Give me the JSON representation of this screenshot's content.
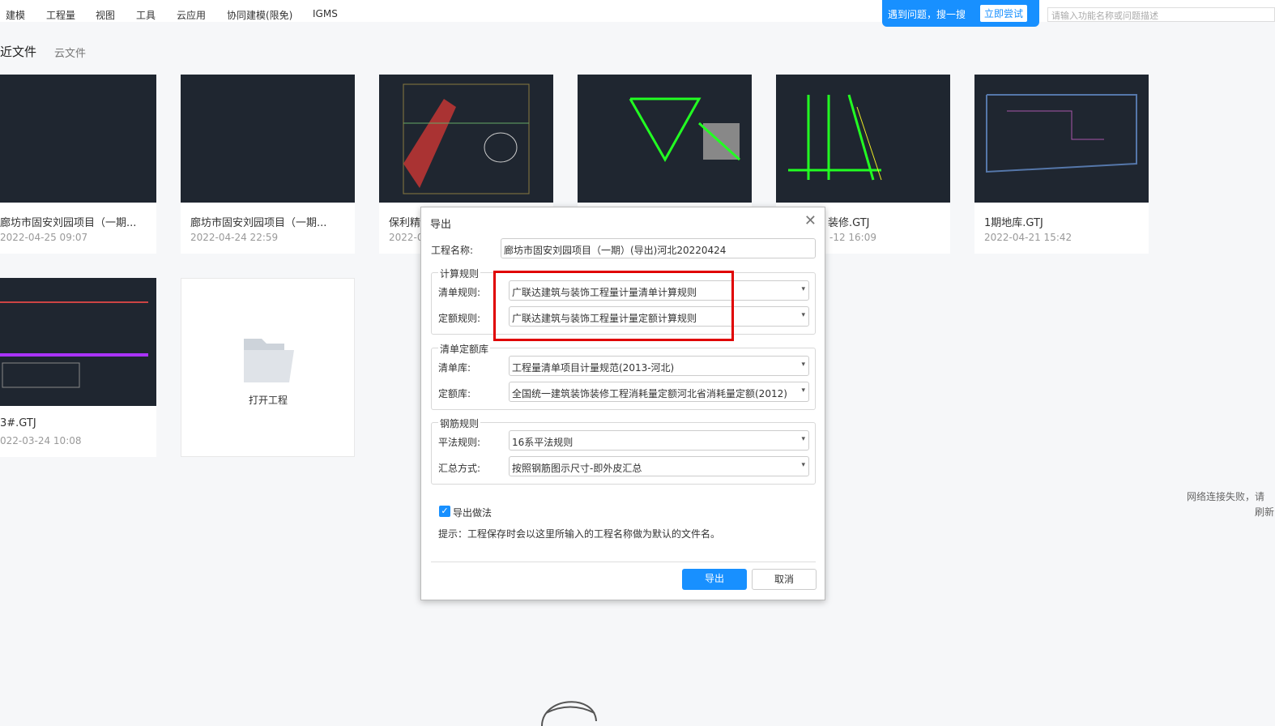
{
  "menu": [
    "建模",
    "工程量",
    "视图",
    "工具",
    "云应用",
    "协同建模(限免)",
    "IGMS"
  ],
  "help": {
    "text": "遇到问题，搜一搜",
    "button": "立即尝试",
    "search_placeholder": "请输入功能名称或问题描述"
  },
  "tabs": {
    "recent": "近文件",
    "cloud": "云文件"
  },
  "cards": [
    {
      "name": "廊坊市固安刘园项目（一期...",
      "date": "2022-04-25 09:07"
    },
    {
      "name": "廊坊市固安刘园项目（一期...",
      "date": "2022-04-24 22:59"
    },
    {
      "name": "保利精",
      "date": "2022-0"
    },
    {
      "name": "",
      "date": ""
    },
    {
      "name": "装修.GTJ",
      "date": "-12 16:09"
    },
    {
      "name": "1期地库.GTJ",
      "date": "2022-04-21 15:42"
    },
    {
      "name": "3#.GTJ",
      "date": "022-03-24 10:08"
    }
  ],
  "open_project": "打开工程",
  "network_error": {
    "line1": "网络连接失败，请",
    "line2": "刷新"
  },
  "dialog": {
    "title": "导出",
    "project_name_label": "工程名称:",
    "project_name": "廊坊市固安刘园项目（一期）(导出)河北20220424",
    "calc_rules": {
      "title": "计算规则",
      "list_label": "清单规则:",
      "list_value": "广联达建筑与装饰工程量计量清单计算规则",
      "quota_label": "定额规则:",
      "quota_value": "广联达建筑与装饰工程量计量定额计算规则"
    },
    "libraries": {
      "title": "清单定额库",
      "list_label": "清单库:",
      "list_value": "工程量清单项目计量规范(2013-河北)",
      "quota_label": "定额库:",
      "quota_value": "全国统一建筑装饰装修工程消耗量定额河北省消耗量定额(2012)"
    },
    "rebar": {
      "title": "钢筋规则",
      "rule_label": "平法规则:",
      "rule_value": "16系平法规则",
      "summary_label": "汇总方式:",
      "summary_value": "按照钢筋图示尺寸-即外皮汇总"
    },
    "export_method": {
      "label": "导出做法",
      "checked": true
    },
    "hint": "提示：工程保存时会以这里所输入的工程名称做为默认的文件名。",
    "export_button": "导出",
    "cancel_button": "取消"
  },
  "colors": {
    "accent": "#1890ff",
    "highlight": "#e00000"
  }
}
